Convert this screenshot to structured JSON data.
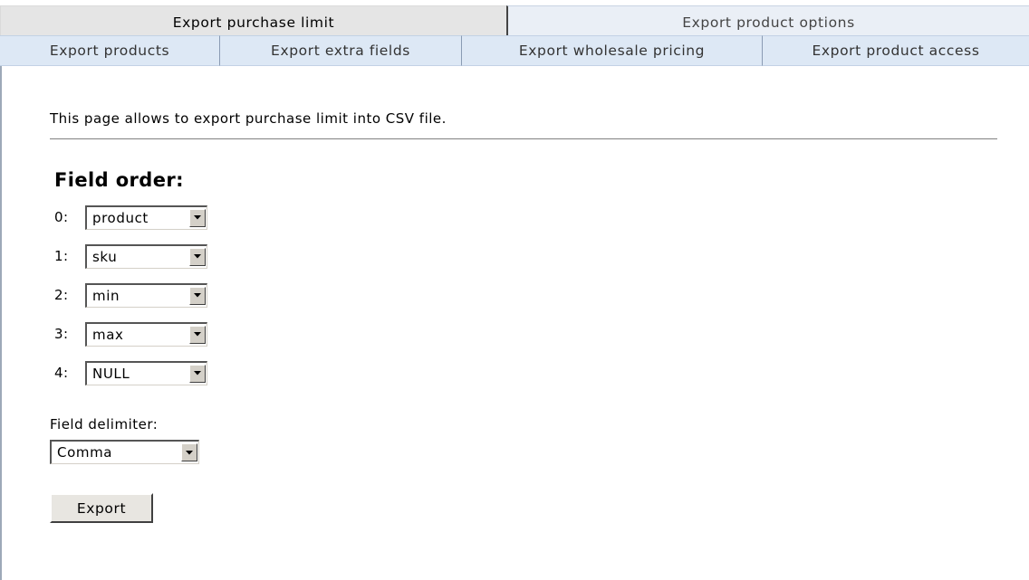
{
  "tabs": {
    "top": [
      {
        "label": "Export purchase limit"
      },
      {
        "label": "Export product options"
      }
    ],
    "bottom": [
      {
        "label": "Export products"
      },
      {
        "label": "Export extra fields"
      },
      {
        "label": "Export wholesale pricing"
      },
      {
        "label": "Export product access"
      }
    ]
  },
  "main": {
    "intro": "This page allows to export purchase limit into CSV file.",
    "heading": "Field order:",
    "fields": [
      {
        "label": "0:",
        "value": "product"
      },
      {
        "label": "1:",
        "value": "sku"
      },
      {
        "label": "2:",
        "value": "min"
      },
      {
        "label": "3:",
        "value": "max"
      },
      {
        "label": "4:",
        "value": "NULL"
      }
    ],
    "delimiter": {
      "label": "Field delimiter:",
      "value": "Comma"
    },
    "export_button": "Export"
  },
  "icons": {
    "select_arrow": "chevron-down-icon"
  },
  "colors": {
    "active_tab": "#e5e5e5",
    "inactive_tab": "#eaeff6",
    "secondary_tab": "#dde8f5",
    "button_face": "#e8e6e1"
  }
}
